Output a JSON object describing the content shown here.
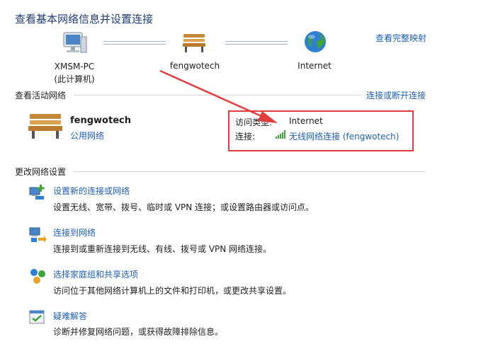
{
  "header": {
    "title": "查看基本网络信息并设置连接",
    "full_map_link": "查看完整映射"
  },
  "network_map": {
    "computer": {
      "name": "XMSM-PC",
      "sub": "(此计算机)"
    },
    "network": {
      "name": "fengwotech"
    },
    "internet": {
      "name": "Internet"
    }
  },
  "active_networks": {
    "label": "查看活动网络",
    "connect_link": "连接或断开连接",
    "network_name": "fengwotech",
    "network_type_link": "公用网络",
    "access_type_label": "访问类型:",
    "access_type_value": "Internet",
    "connection_label": "连接:",
    "connection_value": "无线网络连接 (fengwotech)"
  },
  "change_settings": {
    "label": "更改网络设置",
    "tasks": [
      {
        "title": "设置新的连接或网络",
        "desc": "设置无线、宽带、拨号、临时或 VPN 连接；或设置路由器或访问点。"
      },
      {
        "title": "连接到网络",
        "desc": "连接到或重新连接到无线、有线、拨号或 VPN 网络连接。"
      },
      {
        "title": "选择家庭组和共享选项",
        "desc": "访问位于其他网络计算机上的文件和打印机，或更改共享设置。"
      },
      {
        "title": "疑难解答",
        "desc": "诊断并修复网络问题，或获得故障排除信息。"
      }
    ]
  },
  "colors": {
    "link": "#1e5fb4",
    "title": "#1e3d7a",
    "highlight": "#e23b3b",
    "arrow": "#e23b3b"
  }
}
